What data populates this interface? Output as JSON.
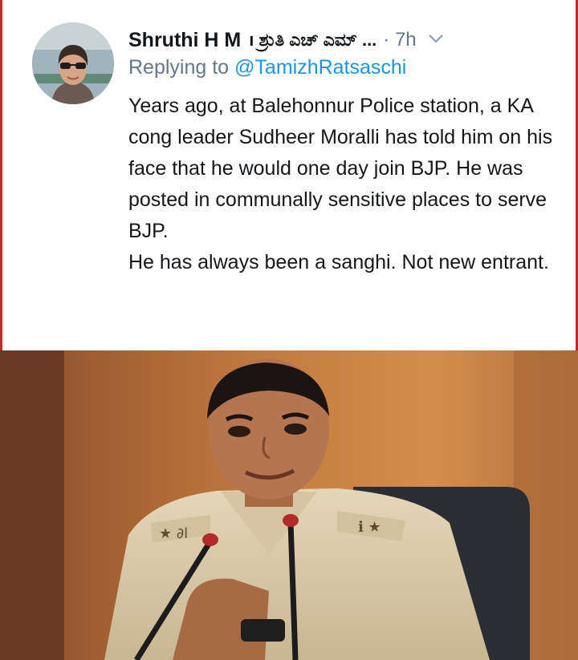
{
  "tweet": {
    "author_name": "Shruthi H M",
    "author_name_kannada": "ı ಶ್ರುತಿ ಎಚ್ ಎಮ್ ...",
    "timestamp": "· 7h",
    "reply_prefix": "Replying to",
    "reply_handle": "@TamizhRatsaschi",
    "paragraph_1": "Years ago, at Balehonnur Police station, a KA cong leader Sudheer Moralli has told him on his face that he would one day join BJP. He was posted in communally sensitive places to serve BJP.",
    "paragraph_2": "He has always been a sanghi. Not new entrant.",
    "menu_icon": "chevron-down-icon"
  },
  "colors": {
    "accent_border": "#c8262b",
    "link": "#1b95e0",
    "muted": "#657786",
    "text": "#14171a"
  }
}
